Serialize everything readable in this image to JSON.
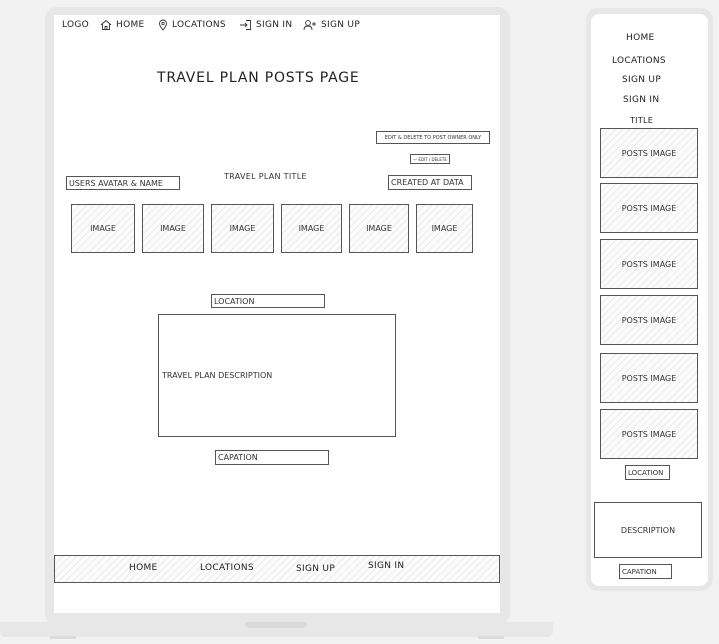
{
  "desktop": {
    "nav": {
      "logo": "LOGO",
      "home": "HOME",
      "locations": "LOCATIONS",
      "sign_in": "SIGN IN",
      "sign_up": "SIGN UP"
    },
    "page_title": "TRAVEL PLAN POSTS PAGE",
    "owner_note": "EDIT & DELETE TO POST OWNER ONLY",
    "edit_delete": "— EDIT / DELETE",
    "avatar_name": "USERS AVATAR & NAME",
    "plan_title": "TRAVEL PLAN TITLE",
    "created_at": "CREATED AT DATA",
    "images": [
      "IMAGE",
      "IMAGE",
      "IMAGE",
      "IMAGE",
      "IMAGE",
      "IMAGE"
    ],
    "location": "LOCATION",
    "description": "TRAVEL PLAN DESCRIPTION",
    "caption": "CAPATION",
    "footer": {
      "home": "HOME",
      "locations": "LOCATIONS",
      "sign_up": "SIGN UP",
      "sign_in": "SIGN IN"
    }
  },
  "mobile": {
    "nav": {
      "home": "HOME",
      "locations": "LOCATIONS",
      "sign_up": "SIGN UP",
      "sign_in": "SIGN IN"
    },
    "title": "TITLE",
    "images": [
      "POSTS IMAGE",
      "POSTS IMAGE",
      "POSTS IMAGE",
      "POSTS IMAGE",
      "POSTS IMAGE",
      "POSTS IMAGE"
    ],
    "location": "LOCATION",
    "description": "DESCRIPTION",
    "caption": "CAPATION"
  }
}
